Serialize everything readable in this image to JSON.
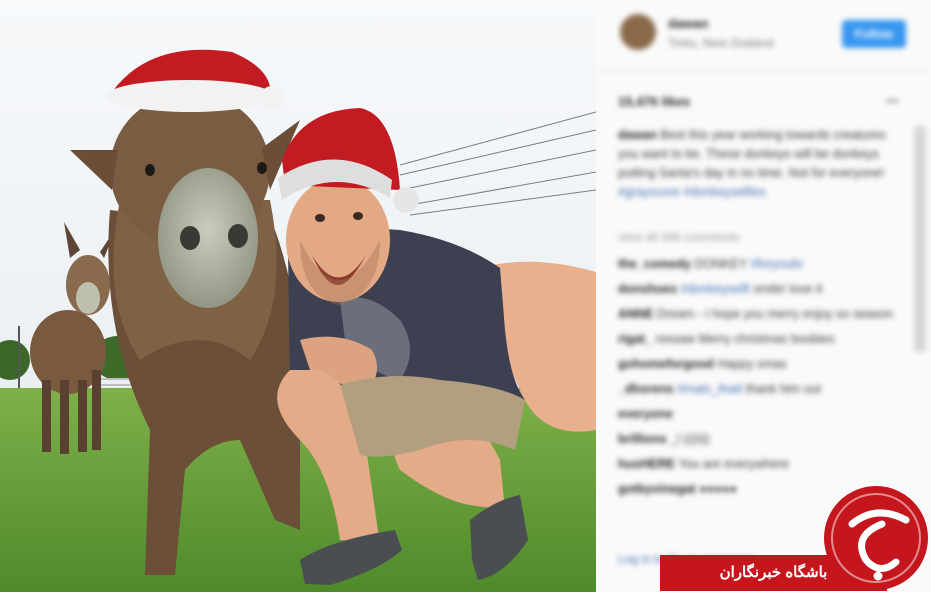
{
  "post": {
    "username": "dawan",
    "location": "Tinks, New Zealand",
    "follow_label": "Follow",
    "likes": "15,476 likes",
    "caption_user": "dawan",
    "caption_text": "Best this year working towards creatures you want to be. These donkeys will be donkeys putting Santa's day in no time. Not for everyone!",
    "caption_tags": "#grayscore #donkeyselfies",
    "view_all": "view all 346 comments",
    "last_line": "Log in to like or comment."
  },
  "comments": [
    {
      "user": "the_comedy",
      "text": "DONKEY",
      "tag": "#foryoubr"
    },
    {
      "user": "donshoes",
      "text": "",
      "tag": "#donkeyselfi",
      "text2": "smile! love it"
    },
    {
      "user": "ANNE",
      "text": "Dream - I hope you merry enjoy so seasonal to day - so it felt..."
    },
    {
      "user": "rigat_",
      "text": "ressaw Merry christmas boobies"
    },
    {
      "user": "gohomeforgood",
      "text": "Happy xmas"
    },
    {
      "user": "_dhsrens",
      "text": "",
      "tag": "#mats_thatt",
      "text2": "thank him out"
    },
    {
      "user": "everyone",
      "text": ""
    },
    {
      "user": "brillions",
      "text": "_l (((ii))"
    },
    {
      "user": "husHERE",
      "text": "You are everywhere"
    },
    {
      "user": "gotbyvinegat",
      "text": "●●●●●"
    }
  ],
  "watermark": {
    "text": "باشگاه خبرنگاران",
    "logo_glyph": "ج",
    "color": "#c4161c"
  },
  "photo": {
    "subject": "man-with-donkeys-in-santa-hats-icon"
  }
}
